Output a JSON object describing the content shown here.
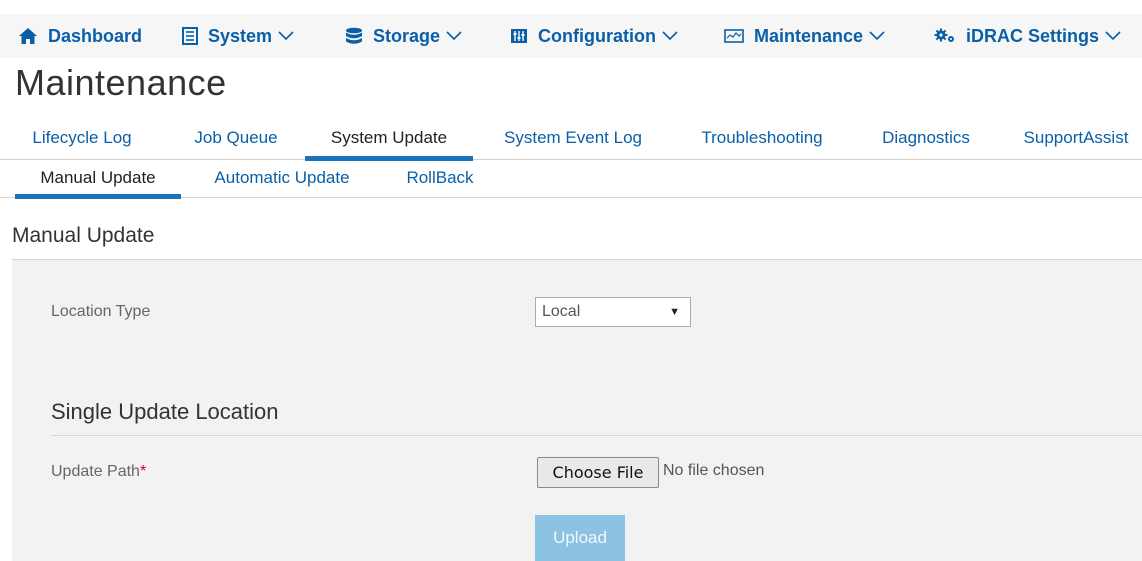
{
  "nav": {
    "items": [
      {
        "label": "Dashboard",
        "icon": "home-icon",
        "has_dropdown": false
      },
      {
        "label": "System",
        "icon": "server-icon",
        "has_dropdown": true
      },
      {
        "label": "Storage",
        "icon": "database-icon",
        "has_dropdown": true
      },
      {
        "label": "Configuration",
        "icon": "configuration-icon",
        "has_dropdown": true
      },
      {
        "label": "Maintenance",
        "icon": "monitor-icon",
        "has_dropdown": true
      },
      {
        "label": "iDRAC Settings",
        "icon": "gears-icon",
        "has_dropdown": true
      }
    ],
    "link_color": "#0a5fa8"
  },
  "page": {
    "title": "Maintenance"
  },
  "tabs": [
    {
      "label": "Lifecycle Log",
      "active": false
    },
    {
      "label": "Job Queue",
      "active": false
    },
    {
      "label": "System Update",
      "active": true
    },
    {
      "label": "System Event Log",
      "active": false
    },
    {
      "label": "Troubleshooting",
      "active": false
    },
    {
      "label": "Diagnostics",
      "active": false
    },
    {
      "label": "SupportAssist",
      "active": false
    }
  ],
  "subtabs": [
    {
      "label": "Manual Update",
      "active": true
    },
    {
      "label": "Automatic Update",
      "active": false
    },
    {
      "label": "RollBack",
      "active": false
    }
  ],
  "section": {
    "title": "Manual Update"
  },
  "form": {
    "location_type_label": "Location Type",
    "location_type_value": "Local",
    "single_update_title": "Single Update Location",
    "update_path_label": "Update Path",
    "required_marker": "*",
    "choose_file_label": "Choose File",
    "file_status": "No file chosen",
    "upload_label": "Upload"
  },
  "colors": {
    "accent": "#1a73b8",
    "upload_disabled": "#8cc2e2",
    "required": "#d0021b"
  }
}
